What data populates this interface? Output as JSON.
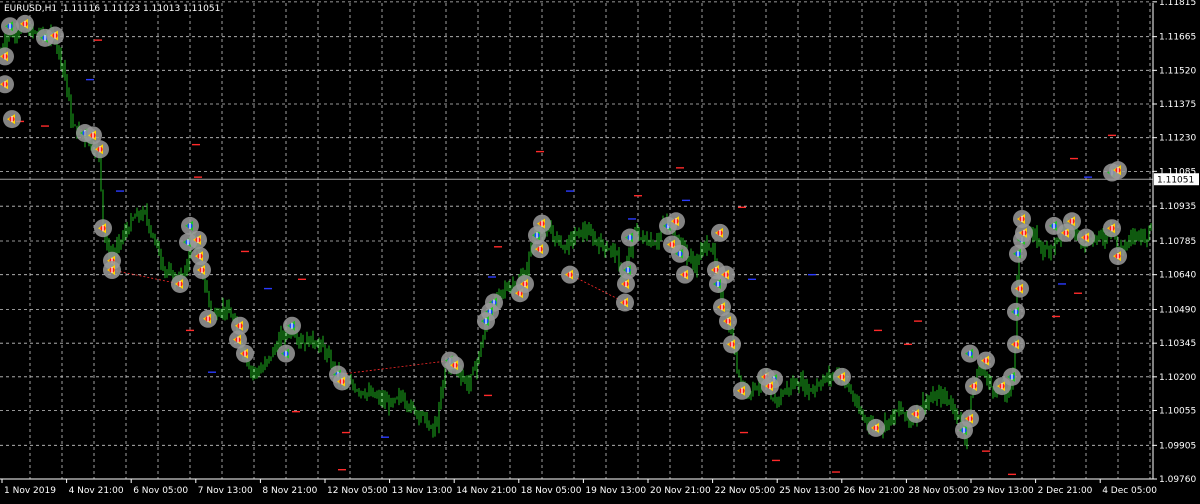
{
  "header": {
    "symbol_label": "EURUSD,H1",
    "ohlc_label": "1.11116 1.11123 1.11013 1.11051"
  },
  "theme": {
    "background": "#000000",
    "grid": "#c8c8c8",
    "axis_text": "#ffffff",
    "bull": "#22c722",
    "bear": "#22c722",
    "current_line": "#a0a0a0",
    "price_box_bg": "#ffffff",
    "price_box_text": "#000000",
    "marker_halo": "#9a9a9a",
    "marker_buy": "#1a4cff",
    "marker_sell": "#ff1a1a",
    "marker_arrow": "#ffd400",
    "marker_arrow_green": "#22c722",
    "dash_red": "#ff2a2a",
    "dash_blue": "#2a3aff",
    "trade_line": "#ff2a2a"
  },
  "chart_data": {
    "type": "candlestick",
    "symbol": "EURUSD",
    "timeframe": "H1",
    "last_price": 1.11051,
    "ylim": [
      1.0976,
      1.1181
    ],
    "y_tick_labels": [
      "1.11815",
      "1.11665",
      "1.11520",
      "1.11375",
      "1.11230",
      "1.11085",
      "1.10935",
      "1.10785",
      "1.10640",
      "1.10490",
      "1.10345",
      "1.10200",
      "1.10055",
      "1.09905",
      "1.09760"
    ],
    "y_tick_values": [
      1.11815,
      1.11665,
      1.1152,
      1.11375,
      1.1123,
      1.11085,
      1.10935,
      1.10785,
      1.1064,
      1.1049,
      1.10345,
      1.102,
      1.10055,
      1.09905,
      1.0976
    ],
    "x_tick_labels": [
      "1 Nov 2019",
      "4 Nov 21:00",
      "6 Nov 05:00",
      "7 Nov 13:00",
      "8 Nov 21:00",
      "12 Nov 05:00",
      "13 Nov 13:00",
      "14 Nov 21:00",
      "18 Nov 05:00",
      "19 Nov 13:00",
      "20 Nov 21:00",
      "22 Nov 05:00",
      "25 Nov 13:00",
      "26 Nov 21:00",
      "28 Nov 05:00",
      "29 Nov 13:00",
      "2 Dec 21:00",
      "4 Dec 05:00"
    ],
    "price_path": [
      [
        0,
        1.1158
      ],
      [
        5,
        1.1166
      ],
      [
        15,
        1.1169
      ],
      [
        25,
        1.117
      ],
      [
        35,
        1.1168
      ],
      [
        45,
        1.1167
      ],
      [
        55,
        1.1166
      ],
      [
        65,
        1.115
      ],
      [
        72,
        1.1128
      ],
      [
        80,
        1.1125
      ],
      [
        90,
        1.1121
      ],
      [
        100,
        1.1116
      ],
      [
        102,
        1.1088
      ],
      [
        108,
        1.1072
      ],
      [
        115,
        1.1074
      ],
      [
        125,
        1.1082
      ],
      [
        135,
        1.1089
      ],
      [
        145,
        1.109
      ],
      [
        155,
        1.1078
      ],
      [
        165,
        1.1066
      ],
      [
        175,
        1.1062
      ],
      [
        185,
        1.1064
      ],
      [
        192,
        1.1082
      ],
      [
        198,
        1.1074
      ],
      [
        205,
        1.106
      ],
      [
        212,
        1.1046
      ],
      [
        222,
        1.105
      ],
      [
        232,
        1.1046
      ],
      [
        242,
        1.1032
      ],
      [
        252,
        1.1022
      ],
      [
        262,
        1.1023
      ],
      [
        272,
        1.103
      ],
      [
        282,
        1.1038
      ],
      [
        292,
        1.1041
      ],
      [
        302,
        1.1035
      ],
      [
        312,
        1.1036
      ],
      [
        322,
        1.1033
      ],
      [
        332,
        1.1025
      ],
      [
        342,
        1.1018
      ],
      [
        352,
        1.1016
      ],
      [
        362,
        1.1014
      ],
      [
        372,
        1.1012
      ],
      [
        382,
        1.101
      ],
      [
        392,
        1.1008
      ],
      [
        402,
        1.1012
      ],
      [
        412,
        1.1006
      ],
      [
        422,
        1.1004
      ],
      [
        432,
        1.0996
      ],
      [
        438,
        1.1002
      ],
      [
        445,
        1.1024
      ],
      [
        452,
        1.1026
      ],
      [
        460,
        1.1022
      ],
      [
        468,
        1.1016
      ],
      [
        478,
        1.1028
      ],
      [
        488,
        1.1046
      ],
      [
        495,
        1.1052
      ],
      [
        505,
        1.1058
      ],
      [
        515,
        1.106
      ],
      [
        525,
        1.1064
      ],
      [
        535,
        1.1082
      ],
      [
        545,
        1.1084
      ],
      [
        555,
        1.108
      ],
      [
        565,
        1.1076
      ],
      [
        575,
        1.1081
      ],
      [
        585,
        1.1083
      ],
      [
        595,
        1.1079
      ],
      [
        605,
        1.1076
      ],
      [
        615,
        1.1074
      ],
      [
        622,
        1.1062
      ],
      [
        628,
        1.107
      ],
      [
        635,
        1.1082
      ],
      [
        645,
        1.1079
      ],
      [
        655,
        1.1078
      ],
      [
        665,
        1.1086
      ],
      [
        672,
        1.1084
      ],
      [
        680,
        1.1078
      ],
      [
        688,
        1.1072
      ],
      [
        695,
        1.1068
      ],
      [
        705,
        1.1077
      ],
      [
        712,
        1.1076
      ],
      [
        718,
        1.106
      ],
      [
        725,
        1.105
      ],
      [
        732,
        1.1036
      ],
      [
        738,
        1.1022
      ],
      [
        745,
        1.1014
      ],
      [
        755,
        1.1016
      ],
      [
        765,
        1.102
      ],
      [
        772,
        1.1008
      ],
      [
        780,
        1.1012
      ],
      [
        790,
        1.1016
      ],
      [
        800,
        1.1018
      ],
      [
        810,
        1.1014
      ],
      [
        820,
        1.1018
      ],
      [
        830,
        1.102
      ],
      [
        840,
        1.1022
      ],
      [
        850,
        1.1014
      ],
      [
        860,
        1.1004
      ],
      [
        870,
        1.1
      ],
      [
        880,
        1.0998
      ],
      [
        890,
        1.1002
      ],
      [
        900,
        1.1006
      ],
      [
        910,
        1.1
      ],
      [
        920,
        1.1008
      ],
      [
        930,
        1.101
      ],
      [
        940,
        1.1012
      ],
      [
        948,
        1.101
      ],
      [
        958,
        1.1004
      ],
      [
        965,
        1.0994
      ],
      [
        972,
        1.1012
      ],
      [
        980,
        1.1026
      ],
      [
        990,
        1.1016
      ],
      [
        1000,
        1.1014
      ],
      [
        1008,
        1.1012
      ],
      [
        1014,
        1.1024
      ],
      [
        1018,
        1.1074
      ],
      [
        1025,
        1.1082
      ],
      [
        1035,
        1.108
      ],
      [
        1045,
        1.1074
      ],
      [
        1055,
        1.1078
      ],
      [
        1065,
        1.1084
      ],
      [
        1075,
        1.1083
      ],
      [
        1085,
        1.1078
      ],
      [
        1095,
        1.108
      ],
      [
        1105,
        1.108
      ],
      [
        1112,
        1.1086
      ],
      [
        1118,
        1.1074
      ],
      [
        1128,
        1.1078
      ],
      [
        1138,
        1.1082
      ],
      [
        1148,
        1.108
      ],
      [
        1153,
        1.109
      ]
    ],
    "trade_markers": [
      [
        10,
        1.1171,
        "buy"
      ],
      [
        25,
        1.1172,
        "sell"
      ],
      [
        45,
        1.1166,
        "buy"
      ],
      [
        55,
        1.1167,
        "sell"
      ],
      [
        5,
        1.1158,
        "sell"
      ],
      [
        5,
        1.1146,
        "sell"
      ],
      [
        12,
        1.1131,
        "sell"
      ],
      [
        85,
        1.1125,
        "buy"
      ],
      [
        93,
        1.1124,
        "sell"
      ],
      [
        100,
        1.1118,
        "sell"
      ],
      [
        103,
        1.1084,
        "sell"
      ],
      [
        112,
        1.107,
        "sell"
      ],
      [
        112,
        1.1066,
        "sell"
      ],
      [
        180,
        1.106,
        "sell"
      ],
      [
        190,
        1.1085,
        "buy"
      ],
      [
        188,
        1.1078,
        "buy"
      ],
      [
        198,
        1.1079,
        "sell"
      ],
      [
        200,
        1.1072,
        "sell"
      ],
      [
        202,
        1.1066,
        "sell"
      ],
      [
        208,
        1.1045,
        "sell"
      ],
      [
        240,
        1.1042,
        "sell"
      ],
      [
        238,
        1.1036,
        "sell"
      ],
      [
        245,
        1.103,
        "sell"
      ],
      [
        292,
        1.1042,
        "buy"
      ],
      [
        286,
        1.103,
        "buy"
      ],
      [
        338,
        1.1021,
        "buy"
      ],
      [
        342,
        1.1018,
        "sell"
      ],
      [
        450,
        1.1027,
        "buy"
      ],
      [
        455,
        1.1025,
        "sell"
      ],
      [
        494,
        1.1052,
        "buy"
      ],
      [
        490,
        1.1048,
        "buy"
      ],
      [
        486,
        1.1044,
        "buy"
      ],
      [
        520,
        1.1056,
        "sell"
      ],
      [
        525,
        1.106,
        "sell"
      ],
      [
        537,
        1.1081,
        "buy"
      ],
      [
        542,
        1.1086,
        "sell"
      ],
      [
        540,
        1.1075,
        "sell"
      ],
      [
        570,
        1.1064,
        "sell"
      ],
      [
        630,
        1.108,
        "buy"
      ],
      [
        628,
        1.1066,
        "buy"
      ],
      [
        626,
        1.106,
        "sell"
      ],
      [
        625,
        1.1052,
        "sell"
      ],
      [
        668,
        1.1085,
        "buy"
      ],
      [
        676,
        1.1087,
        "sell"
      ],
      [
        672,
        1.1077,
        "sell"
      ],
      [
        680,
        1.1073,
        "buy"
      ],
      [
        685,
        1.1064,
        "sell"
      ],
      [
        720,
        1.1082,
        "sell"
      ],
      [
        716,
        1.1066,
        "sell"
      ],
      [
        726,
        1.1064,
        "sell"
      ],
      [
        718,
        1.106,
        "buy"
      ],
      [
        722,
        1.105,
        "sell"
      ],
      [
        728,
        1.1044,
        "sell"
      ],
      [
        732,
        1.1034,
        "sell"
      ],
      [
        742,
        1.1014,
        "sell"
      ],
      [
        766,
        1.102,
        "sell"
      ],
      [
        774,
        1.1019,
        "buy"
      ],
      [
        770,
        1.1016,
        "sell"
      ],
      [
        842,
        1.102,
        "sell"
      ],
      [
        876,
        1.0998,
        "sell"
      ],
      [
        916,
        1.1004,
        "sell"
      ],
      [
        964,
        1.0997,
        "buy"
      ],
      [
        970,
        1.1002,
        "sell"
      ],
      [
        970,
        1.103,
        "buy"
      ],
      [
        986,
        1.1027,
        "sell"
      ],
      [
        974,
        1.1016,
        "sell"
      ],
      [
        1002,
        1.1016,
        "sell"
      ],
      [
        1012,
        1.102,
        "buy"
      ],
      [
        1016,
        1.1034,
        "sell"
      ],
      [
        1016,
        1.1048,
        "buy"
      ],
      [
        1020,
        1.1058,
        "sell"
      ],
      [
        1018,
        1.1073,
        "buy"
      ],
      [
        1022,
        1.1079,
        "buy"
      ],
      [
        1024,
        1.1082,
        "sell"
      ],
      [
        1022,
        1.1088,
        "sell"
      ],
      [
        1054,
        1.1085,
        "buy"
      ],
      [
        1066,
        1.1082,
        "sell"
      ],
      [
        1072,
        1.1087,
        "sell"
      ],
      [
        1086,
        1.108,
        "sell"
      ],
      [
        1112,
        1.1084,
        "sell"
      ],
      [
        1118,
        1.1072,
        "sell"
      ],
      [
        1112,
        1.1108,
        "buy"
      ],
      [
        1118,
        1.1109,
        "sell"
      ]
    ],
    "pending_order_dashes": [
      [
        20,
        1.113,
        "red"
      ],
      [
        98,
        1.1165,
        "red"
      ],
      [
        90,
        1.1148,
        "blue"
      ],
      [
        45,
        1.1128,
        "red"
      ],
      [
        196,
        1.112,
        "red"
      ],
      [
        198,
        1.1106,
        "red"
      ],
      [
        120,
        1.11,
        "blue"
      ],
      [
        245,
        1.1074,
        "red"
      ],
      [
        302,
        1.1062,
        "red"
      ],
      [
        268,
        1.1058,
        "blue"
      ],
      [
        190,
        1.104,
        "red"
      ],
      [
        212,
        1.1022,
        "blue"
      ],
      [
        296,
        1.1005,
        "red"
      ],
      [
        346,
        1.0996,
        "red"
      ],
      [
        342,
        1.098,
        "red"
      ],
      [
        385,
        1.0994,
        "blue"
      ],
      [
        488,
        1.1012,
        "red"
      ],
      [
        492,
        1.1063,
        "blue"
      ],
      [
        498,
        1.1076,
        "red"
      ],
      [
        540,
        1.1117,
        "red"
      ],
      [
        570,
        1.11,
        "blue"
      ],
      [
        632,
        1.1088,
        "blue"
      ],
      [
        638,
        1.1098,
        "red"
      ],
      [
        680,
        1.111,
        "red"
      ],
      [
        686,
        1.1096,
        "blue"
      ],
      [
        742,
        1.1093,
        "red"
      ],
      [
        752,
        1.1062,
        "blue"
      ],
      [
        812,
        1.1064,
        "blue"
      ],
      [
        878,
        1.104,
        "red"
      ],
      [
        918,
        1.1044,
        "red"
      ],
      [
        908,
        1.1034,
        "red"
      ],
      [
        744,
        1.0996,
        "red"
      ],
      [
        776,
        1.0984,
        "red"
      ],
      [
        836,
        1.0979,
        "red"
      ],
      [
        986,
        1.0988,
        "red"
      ],
      [
        1012,
        1.0978,
        "red"
      ],
      [
        1062,
        1.106,
        "blue"
      ],
      [
        1056,
        1.1046,
        "red"
      ],
      [
        1078,
        1.1056,
        "red"
      ],
      [
        1074,
        1.1114,
        "red"
      ],
      [
        1088,
        1.1106,
        "blue"
      ],
      [
        1112,
        1.1124,
        "red"
      ]
    ],
    "xlabel": "",
    "ylabel": ""
  }
}
